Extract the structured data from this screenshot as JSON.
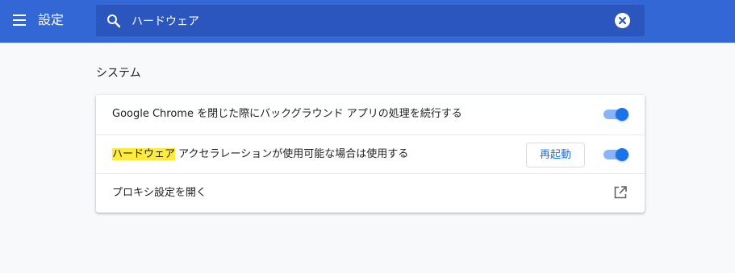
{
  "header": {
    "title": "設定",
    "menu_icon": "hamburger-menu-icon",
    "search": {
      "value": "ハードウェア",
      "search_icon": "search-icon",
      "clear_icon": "close-icon"
    },
    "colors": {
      "bar": "#3367d6",
      "search_field": "#2a56bd"
    }
  },
  "section": {
    "title": "システム",
    "rows": [
      {
        "label": "Google Chrome を閉じた際にバックグラウンド アプリの処理を続行する",
        "toggle_on": true
      },
      {
        "label_highlight": "ハードウェア",
        "label_rest": " アクセラレーションが使用可能な場合は使用する",
        "button": "再起動",
        "toggle_on": true
      },
      {
        "label": "プロキシ設定を開く",
        "icon": "open-in-new-icon"
      }
    ]
  },
  "colors": {
    "accent": "#1a73e8",
    "toggle_track": "#8ab4f8",
    "highlight": "#ffeb3b"
  }
}
